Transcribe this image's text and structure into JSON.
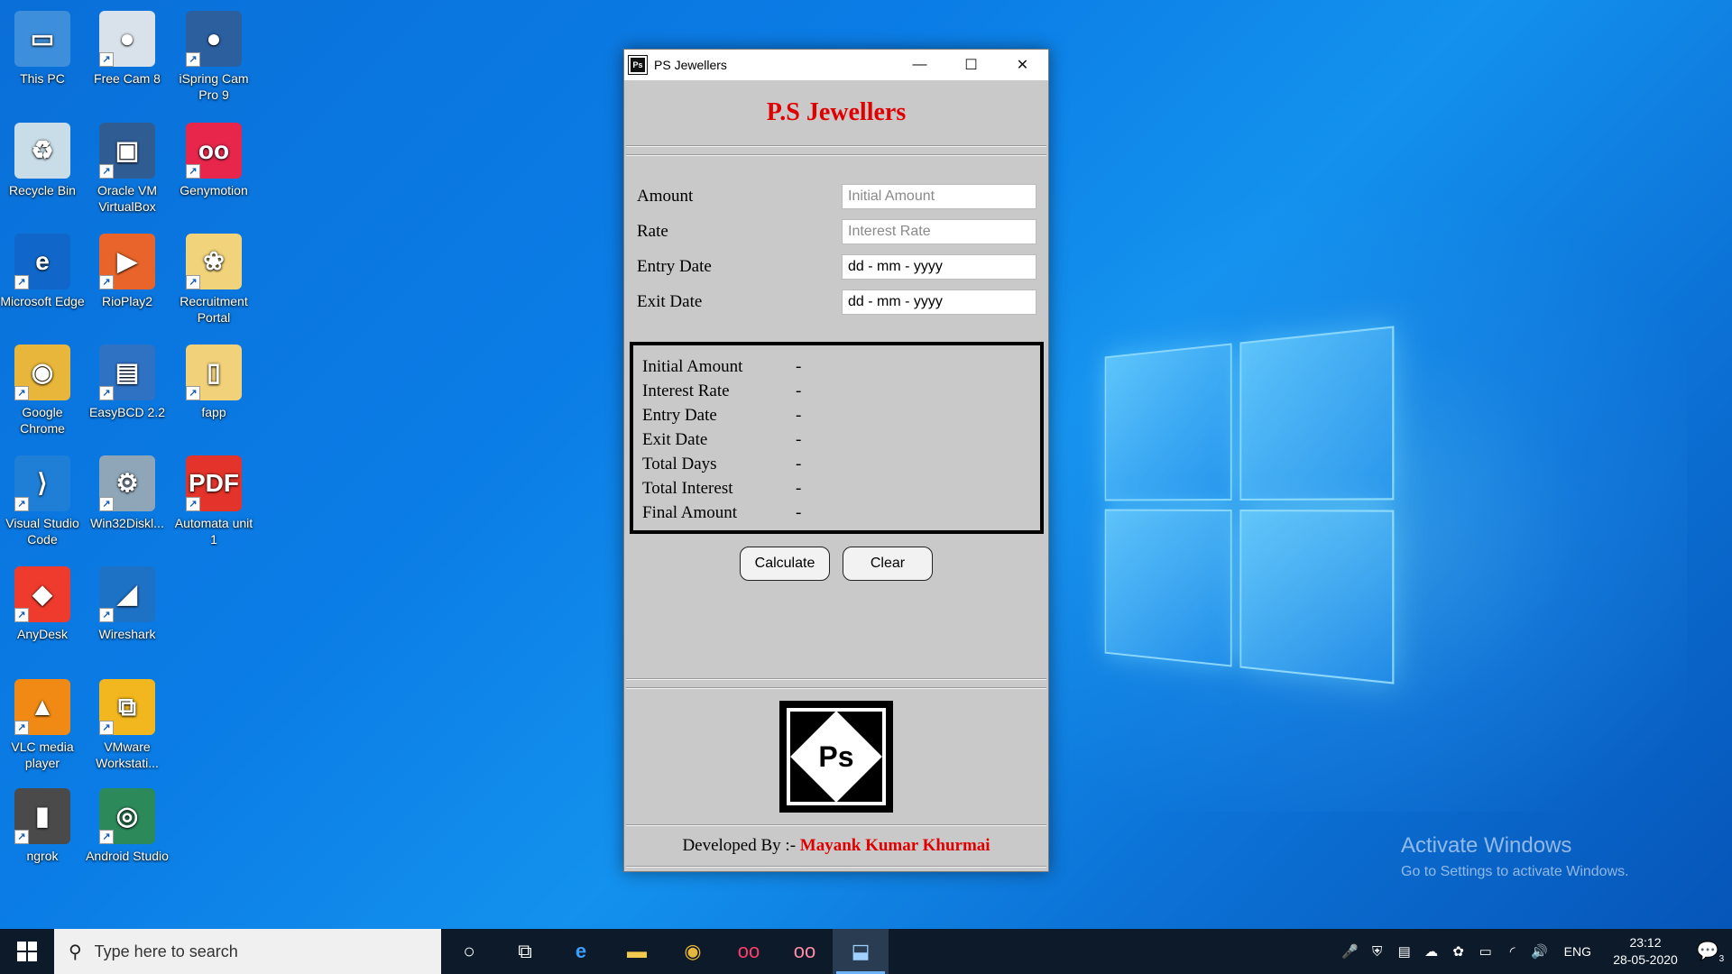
{
  "desktop": {
    "icons": [
      {
        "label": "This PC",
        "color": "#3d8fdc",
        "glyph": "▭"
      },
      {
        "label": "Free Cam 8",
        "color": "#d9e2ea",
        "glyph": "●"
      },
      {
        "label": "iSpring Cam Pro 9",
        "color": "#2b5f9e",
        "glyph": "●"
      },
      {
        "label": "Recycle Bin",
        "color": "#c9dde8",
        "glyph": "♻"
      },
      {
        "label": "Oracle VM VirtualBox",
        "color": "#2f5d93",
        "glyph": "▣"
      },
      {
        "label": "Genymotion",
        "color": "#e8264c",
        "glyph": "oo"
      },
      {
        "label": "Microsoft Edge",
        "color": "#1167c9",
        "glyph": "e"
      },
      {
        "label": "RioPlay2",
        "color": "#e8642a",
        "glyph": "▶"
      },
      {
        "label": "Recruitment Portal",
        "color": "#f0d37a",
        "glyph": "❀"
      },
      {
        "label": "Google Chrome",
        "color": "#e8b63a",
        "glyph": "◉"
      },
      {
        "label": "EasyBCD 2.2",
        "color": "#2f72c4",
        "glyph": "▤"
      },
      {
        "label": "fapp",
        "color": "#f1d27a",
        "glyph": "▯"
      },
      {
        "label": "Visual Studio Code",
        "color": "#1f7fd6",
        "glyph": "⟩"
      },
      {
        "label": "Win32Diskl...",
        "color": "#8fa6b8",
        "glyph": "⚙"
      },
      {
        "label": "Automata unit 1",
        "color": "#e3332b",
        "glyph": "PDF"
      },
      {
        "label": "AnyDesk",
        "color": "#ef3b2d",
        "glyph": "◆"
      },
      {
        "label": "Wireshark",
        "color": "#1d72c6",
        "glyph": "◢"
      },
      {
        "label": "VLC media player",
        "color": "#f08a14",
        "glyph": "▲"
      },
      {
        "label": "VMware Workstati...",
        "color": "#f2b71e",
        "glyph": "⧉"
      },
      {
        "label": "ngrok",
        "color": "#4a4a4a",
        "glyph": "▮"
      },
      {
        "label": "Android Studio",
        "color": "#2c8a5a",
        "glyph": "◎"
      }
    ]
  },
  "window": {
    "title": "PS Jewellers",
    "heading": "P.S Jewellers",
    "form": {
      "amount_label": "Amount",
      "amount_placeholder": "Initial Amount",
      "rate_label": "Rate",
      "rate_placeholder": "Interest Rate",
      "entry_label": "Entry Date",
      "entry_value": "dd - mm - yyyy",
      "exit_label": "Exit Date",
      "exit_value": "dd - mm - yyyy"
    },
    "results": [
      {
        "label": "Initial Amount",
        "value": "-"
      },
      {
        "label": "Interest Rate",
        "value": "-"
      },
      {
        "label": "Entry Date",
        "value": "-"
      },
      {
        "label": "Exit Date",
        "value": "-"
      },
      {
        "label": "Total Days",
        "value": "-"
      },
      {
        "label": "Total Interest",
        "value": "-"
      },
      {
        "label": "Final Amount",
        "value": "-"
      }
    ],
    "calculate_label": "Calculate",
    "clear_label": "Clear",
    "logo_text": "Ps",
    "footer_prefix": "Developed By :- ",
    "footer_name": "Mayank Kumar Khurmai",
    "accent_color": "#e00000"
  },
  "watermark": {
    "line1": "Activate Windows",
    "line2": "Go to Settings to activate Windows."
  },
  "taskbar": {
    "search_placeholder": "Type here to search",
    "lang": "ENG",
    "time": "23:12",
    "date": "28-05-2020",
    "notification_count": "3"
  }
}
